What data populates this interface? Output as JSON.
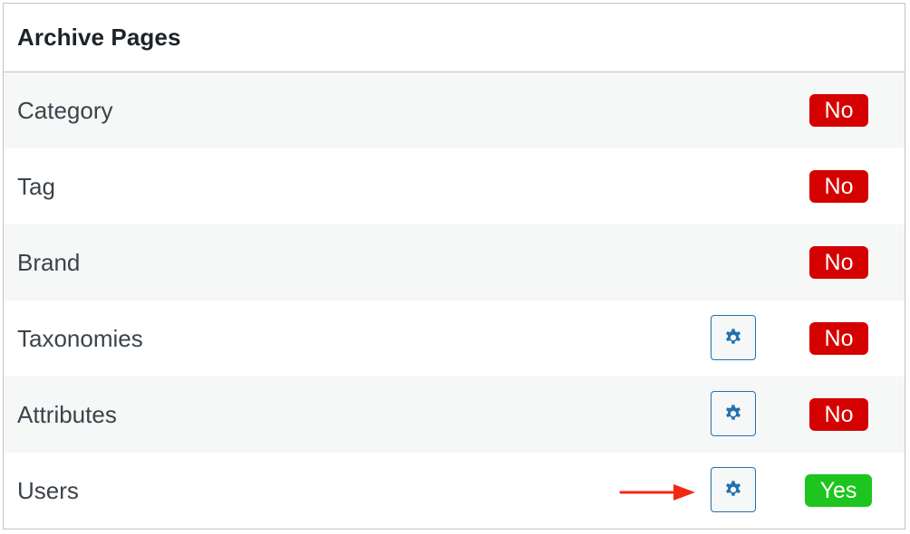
{
  "panel": {
    "title": "Archive Pages"
  },
  "rows": [
    {
      "label": "Category",
      "status": "No",
      "has_settings": false
    },
    {
      "label": "Tag",
      "status": "No",
      "has_settings": false
    },
    {
      "label": "Brand",
      "status": "No",
      "has_settings": false
    },
    {
      "label": "Taxonomies",
      "status": "No",
      "has_settings": true
    },
    {
      "label": "Attributes",
      "status": "No",
      "has_settings": true
    },
    {
      "label": "Users",
      "status": "Yes",
      "has_settings": true
    }
  ],
  "icons": {
    "settings": "gear-icon",
    "pointer": "arrow-right-icon"
  },
  "colors": {
    "no_badge": "#d50000",
    "yes_badge": "#1ec51e",
    "accent": "#2271b1",
    "annotation_arrow": "#f02a12"
  }
}
